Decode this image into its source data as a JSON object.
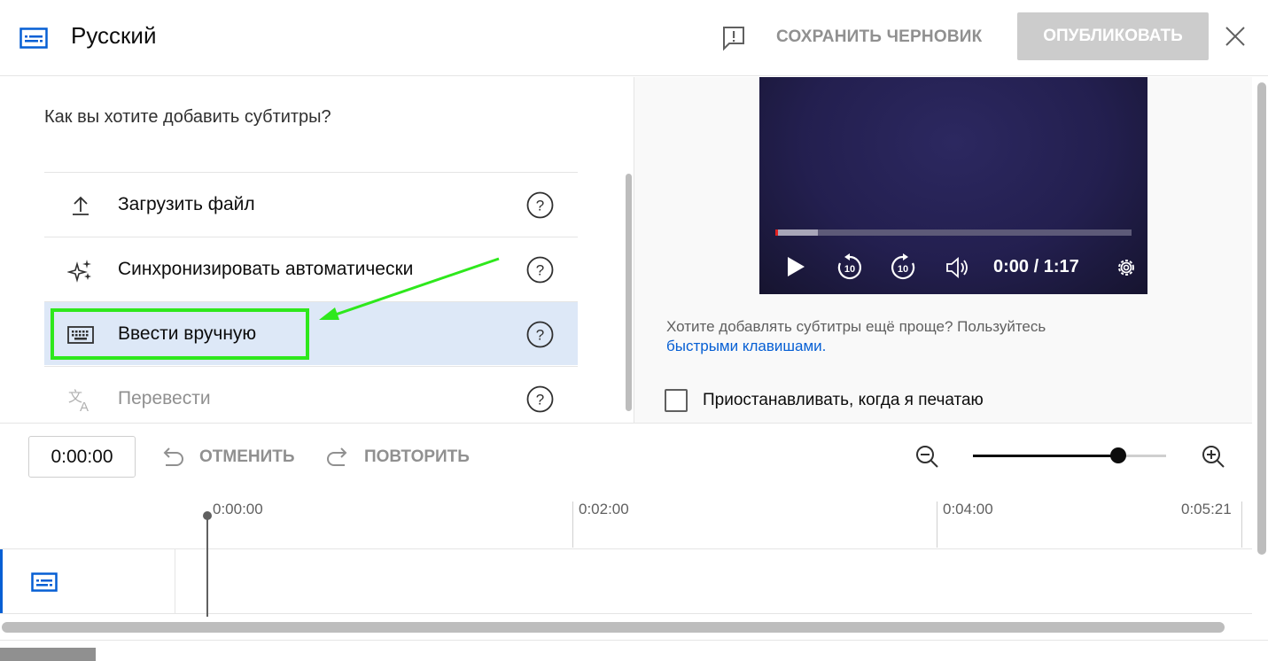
{
  "header": {
    "title": "Русский",
    "save_draft": "СОХРАНИТЬ ЧЕРНОВИК",
    "publish": "ОПУБЛИКОВАТЬ"
  },
  "left": {
    "question": "Как вы хотите добавить субтитры?",
    "options": [
      {
        "label": "Загрузить файл",
        "icon": "upload-icon",
        "state": "normal"
      },
      {
        "label": "Синхронизировать автоматически",
        "icon": "sparkle-icon",
        "state": "normal"
      },
      {
        "label": "Ввести вручную",
        "icon": "keyboard-icon",
        "state": "selected"
      },
      {
        "label": "Перевести",
        "icon": "translate-icon",
        "state": "disabled"
      }
    ]
  },
  "player": {
    "time": "0:00 / 1:17",
    "progress_fraction": 0.12
  },
  "right": {
    "hint_text": "Хотите добавлять субтитры ещё проще? Пользуйтесь",
    "hint_link": "быстрыми клавишами.",
    "pause_label": "Приостанавливать, когда я печатаю",
    "pause_checked": false
  },
  "toolbar": {
    "time_value": "0:00:00",
    "undo": "ОТМЕНИТЬ",
    "redo": "ПОВТОРИТЬ",
    "zoom_fraction": 0.75
  },
  "timeline": {
    "ruler": [
      "0:00:00",
      "0:02:00",
      "0:04:00",
      "0:05:21"
    ]
  },
  "colors": {
    "accent": "#065fd4",
    "selected_bg": "#dde8f7",
    "annotation": "#2ee81c",
    "publish_disabled": "#cccccc"
  }
}
